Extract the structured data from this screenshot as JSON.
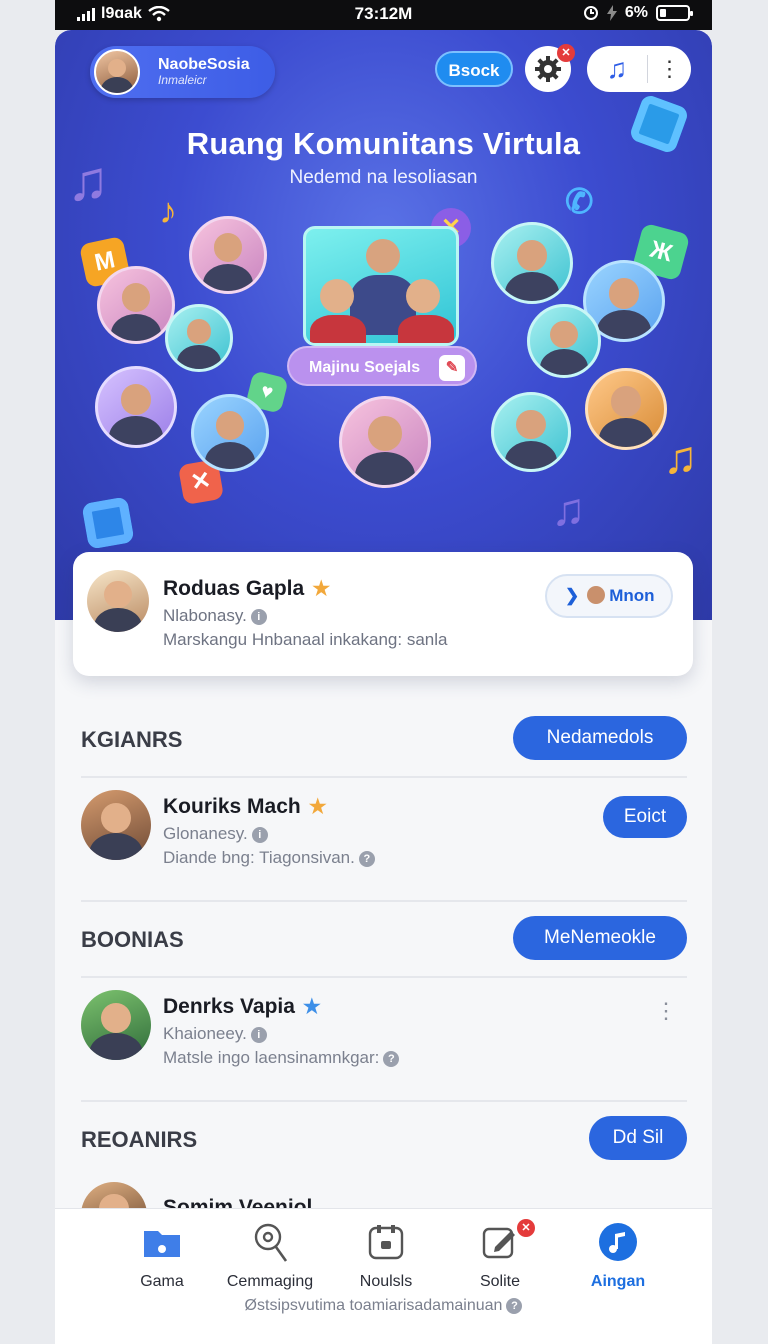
{
  "status_bar": {
    "carrier": "l9ɑak",
    "time": "73:12M",
    "battery": "6%"
  },
  "header": {
    "profile_name": "NaobeSosia",
    "profile_subtitle": "Inmaleicr",
    "book_label": "Bsock",
    "gear_badge": "✕",
    "music_icon": "music-note-icon"
  },
  "hero": {
    "title": "Ruang Komunitans Virtula",
    "subtitle": "Nedemd na lesoliasan",
    "social_chip": "Majinu Soejals"
  },
  "featured": {
    "name": "Roduas Gapla",
    "subtitle": "Nlabonasy.",
    "description": "Marskangu Hnbanaal  inkakang: sanla",
    "action_label": "Mnon"
  },
  "sections": [
    {
      "label": "KGIANRS",
      "button": "Nedamedols",
      "person": {
        "name": "Kouriks Mach",
        "subtitle": "Glonanesy.",
        "description": "Diande bng: Tiagonsivan.",
        "action": "Eoict"
      }
    },
    {
      "label": "BOONIAS",
      "button": "MeNemeokle",
      "person": {
        "name": "Denrks Vapia",
        "subtitle": "Khaioneey.",
        "description": "Matsle ingo laensinamnkgar:"
      }
    },
    {
      "label": "REOANIRS",
      "button": "Dd Sil",
      "person": {
        "name": "Somim Veeniol"
      }
    }
  ],
  "tabbar": {
    "tabs": [
      {
        "label": "Gama",
        "icon": "map-folder-icon"
      },
      {
        "label": "Cemmaging",
        "icon": "location-pin-icon"
      },
      {
        "label": "Noulsls",
        "icon": "notes-icon"
      },
      {
        "label": "Solite",
        "icon": "edit-icon",
        "badge": "✕"
      },
      {
        "label": "Aingan",
        "icon": "music-note-icon"
      }
    ],
    "footer_note": "Østsipsvutima toamiarisadamainuan"
  },
  "colors": {
    "hero": "#3c4cd0",
    "primary_button": "#2b66df",
    "active_tab": "#1d6fe0",
    "badge": "#e43b3b"
  }
}
